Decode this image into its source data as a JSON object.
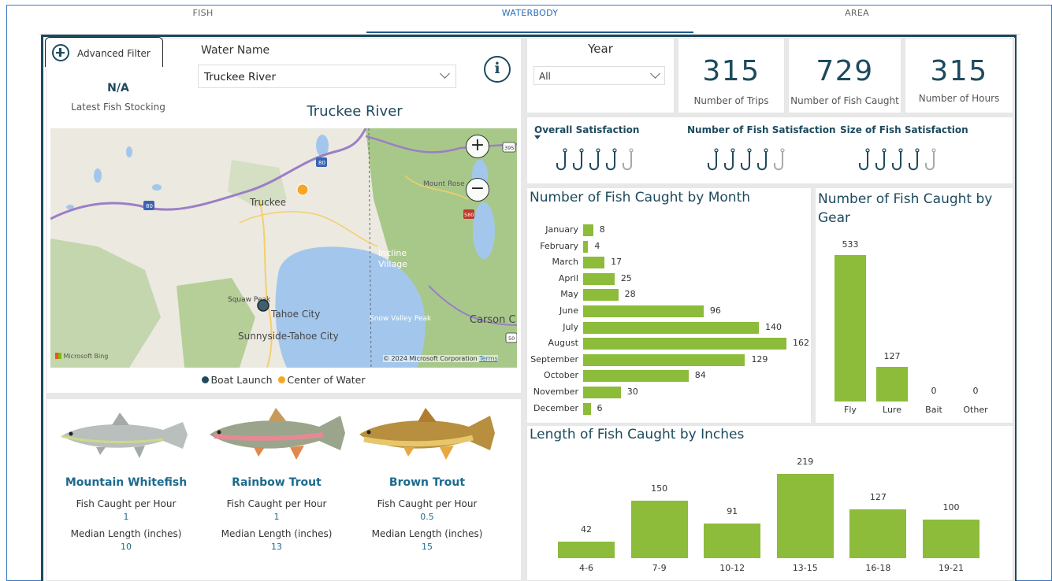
{
  "tabs": [
    {
      "label": "FISH"
    },
    {
      "label": "WATERBODY"
    },
    {
      "label": "AREA"
    }
  ],
  "filter": {
    "label": "Advanced Filter"
  },
  "stocking": {
    "value": "N/A",
    "label": "Latest Fish Stocking"
  },
  "water_name": {
    "label": "Water Name",
    "selected": "Truckee River"
  },
  "map": {
    "title": "Truckee River",
    "places": [
      "Truckee",
      "Incline Village",
      "Mount Rose",
      "Squaw Peak",
      "Tahoe City",
      "Sunnyside-Tahoe City",
      "Snow Valley Peak",
      "Carson C"
    ],
    "highways": [
      "80",
      "80",
      "395",
      "580",
      "50"
    ],
    "attribution_left": "Microsoft Bing",
    "attribution_right": "© 2024 Microsoft Corporation",
    "terms": "Terms",
    "zoom_in": "+",
    "zoom_out": "−"
  },
  "legend": {
    "items": [
      {
        "label": "Boat Launch",
        "color": "#1d4a5e"
      },
      {
        "label": "Center of Water",
        "color": "#f5a623"
      }
    ]
  },
  "fish": [
    {
      "name": "Mountain Whitefish",
      "rate_label": "Fish Caught per Hour",
      "rate": "1",
      "length_label": "Median Length (inches)",
      "length": "10"
    },
    {
      "name": "Rainbow Trout",
      "rate_label": "Fish Caught per Hour",
      "rate": "1",
      "length_label": "Median Length (inches)",
      "length": "13"
    },
    {
      "name": "Brown Trout",
      "rate_label": "Fish Caught per Hour",
      "rate": "0.5",
      "length_label": "Median Length (inches)",
      "length": "15"
    }
  ],
  "year": {
    "label": "Year",
    "selected": "All"
  },
  "kpis": [
    {
      "value": "315",
      "label": "Number of Trips"
    },
    {
      "value": "729",
      "label": "Number of Fish Caught"
    },
    {
      "value": "315",
      "label": "Number of Hours"
    }
  ],
  "satisfaction": [
    {
      "label": "Overall Satisfaction",
      "rating": 4,
      "max": 5
    },
    {
      "label": "Number of Fish Satisfaction",
      "rating": 4,
      "max": 5
    },
    {
      "label": "Size of Fish Satisfaction",
      "rating": 4,
      "max": 5
    }
  ],
  "colors": {
    "accent": "#1d4a5e",
    "bar": "#8dbb3a",
    "tab_active": "#2a6db5"
  },
  "chart_data": [
    {
      "type": "bar",
      "orientation": "horizontal",
      "title": "Number of Fish Caught by Month",
      "categories": [
        "January",
        "February",
        "March",
        "April",
        "May",
        "June",
        "July",
        "August",
        "September",
        "October",
        "November",
        "December"
      ],
      "values": [
        8,
        4,
        17,
        25,
        28,
        96,
        140,
        162,
        129,
        84,
        30,
        6
      ]
    },
    {
      "type": "bar",
      "title": "Number of Fish Caught by Gear",
      "categories": [
        "Fly",
        "Lure",
        "Bait",
        "Other"
      ],
      "values": [
        533,
        127,
        0,
        0
      ]
    },
    {
      "type": "bar",
      "title": "Length of Fish Caught by Inches",
      "categories": [
        "4-6",
        "7-9",
        "10-12",
        "13-15",
        "16-18",
        "19-21"
      ],
      "values": [
        42,
        150,
        91,
        219,
        127,
        100
      ]
    }
  ]
}
